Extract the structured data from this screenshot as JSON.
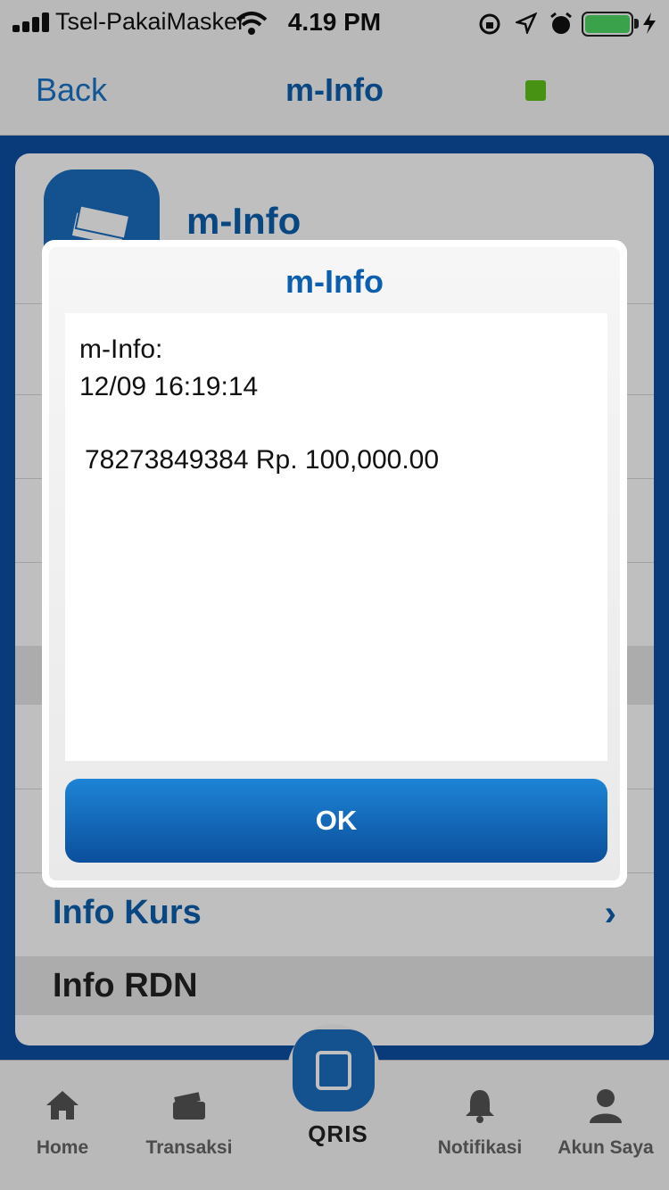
{
  "status_bar": {
    "carrier": "Tsel-PakaiMasker",
    "time": "4.19 PM"
  },
  "navbar": {
    "back_label": "Back",
    "title": "m-Info"
  },
  "card": {
    "title": "m-Info",
    "rows": [
      {
        "label": "Info Kurs"
      },
      {
        "label": "Info RDN"
      }
    ]
  },
  "tabbar": {
    "items": [
      {
        "label": "Home",
        "icon": "home-icon"
      },
      {
        "label": "Transaksi",
        "icon": "wallet-icon"
      },
      {
        "label": "QRIS",
        "icon": "qris-icon"
      },
      {
        "label": "Notifikasi",
        "icon": "bell-icon"
      },
      {
        "label": "Akun Saya",
        "icon": "user-icon"
      }
    ]
  },
  "dialog": {
    "title": "m-Info",
    "line1": "m-Info:",
    "line2": "12/09 16:19:14",
    "line3": "78273849384 Rp. 100,000.00",
    "ok_label": "OK"
  },
  "colors": {
    "primary": "#0b5fae",
    "accent_bg": "#0d4ea3",
    "indicator": "#5fc31a",
    "battery": "#4cd964"
  }
}
